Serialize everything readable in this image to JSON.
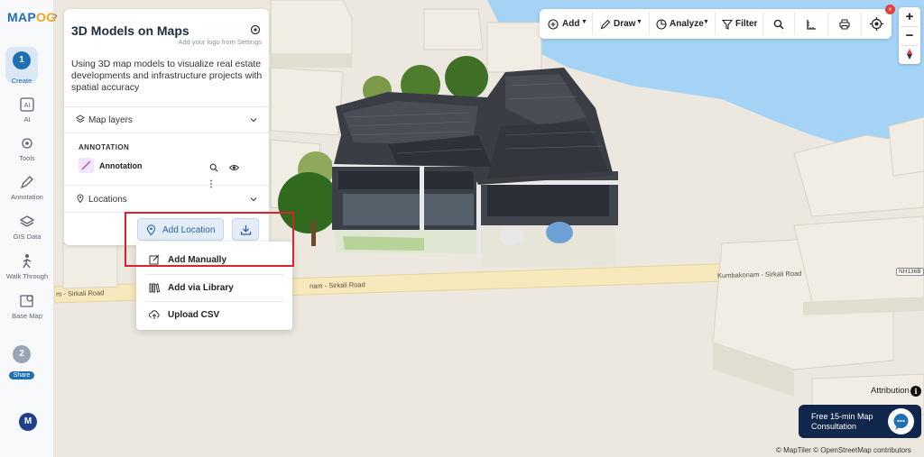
{
  "app": {
    "logo_a": "MAP",
    "logo_b": "OG"
  },
  "rail": {
    "steps": [
      {
        "number": "1",
        "label": "Create",
        "bg": "#dbe7f5",
        "num_bg": "#1f6fb5"
      },
      {
        "number": "2",
        "label": "Share",
        "num_bg": "#9aa5b4"
      }
    ],
    "items": [
      {
        "label": "AI",
        "icon": "ai-icon"
      },
      {
        "label": "Tools",
        "icon": "gear-icon"
      },
      {
        "label": "Annotation",
        "icon": "pen-icon"
      },
      {
        "label": "GIS Data",
        "icon": "layers-icon"
      },
      {
        "label": "Walk Through",
        "icon": "walk-icon"
      },
      {
        "label": "Base Map",
        "icon": "basemap-icon"
      }
    ],
    "avatar": "M"
  },
  "panel": {
    "title": "3D Models on Maps",
    "subtitle": "Add your logo from Settings",
    "description": "Using 3D map models to visualize real estate developments and infrastructure projects with spatial accuracy",
    "map_layers": "Map layers",
    "annotation_heading": "ANNOTATION",
    "annotation_item": "Annotation",
    "locations": "Locations",
    "add_location": "Add Location"
  },
  "dropdown": {
    "items": [
      {
        "label": "Add Manually",
        "icon": "edit-icon"
      },
      {
        "label": "Add via Library",
        "icon": "library-icon"
      },
      {
        "label": "Upload CSV",
        "icon": "cloud-upload-icon"
      }
    ]
  },
  "toolbar": {
    "add": "Add",
    "draw": "Draw",
    "analyze": "Analyze",
    "filter": "Filter"
  },
  "zoom": {
    "in": "+",
    "out": "−"
  },
  "map": {
    "road_label_1": "m - Sirkali Road",
    "road_label_2": "nam - Sirkali Road",
    "road_label_3": "Kumbakonam - Sirkali Road",
    "nh_badge": "NH136B"
  },
  "footer": {
    "attribution": "Attribution",
    "consult": "Free 15-min Map Consultation",
    "credits": "© MapTiler © OpenStreetMap contributors"
  },
  "colors": {
    "accent": "#1f6fb5",
    "highlight": "#d9232e",
    "water": "#a4d3f5",
    "land": "#ece8df",
    "road": "#f5e7b8"
  }
}
